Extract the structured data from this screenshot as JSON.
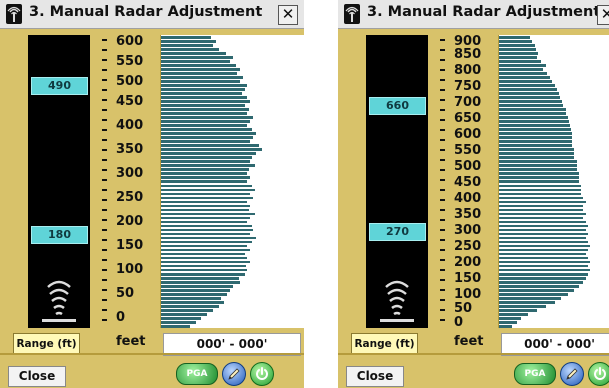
{
  "windows": [
    {
      "title": "3. Manual Radar Adjustment",
      "close_glyph": "✕",
      "ruler_markers": [
        "490",
        "180"
      ],
      "range_button": "Range (ft)",
      "axis_ticks": [
        "600",
        "550",
        "500",
        "450",
        "400",
        "350",
        "300",
        "250",
        "200",
        "150",
        "100",
        "50",
        "0"
      ],
      "axis_unit": "feet",
      "range_readout": "000' -  000'",
      "close_button": "Close",
      "pga_button": "PGA",
      "icons": [
        "radar-antenna-icon",
        "radar-waves-icon",
        "pencil-icon",
        "power-icon"
      ],
      "bar_levels": [
        0.35,
        0.38,
        0.36,
        0.4,
        0.45,
        0.5,
        0.48,
        0.52,
        0.55,
        0.53,
        0.57,
        0.55,
        0.6,
        0.58,
        0.56,
        0.6,
        0.62,
        0.58,
        0.61,
        0.6,
        0.64,
        0.62,
        0.6,
        0.63,
        0.66,
        0.64,
        0.62,
        0.68,
        0.7,
        0.66,
        0.63,
        0.62,
        0.65,
        0.61,
        0.6,
        0.62,
        0.6,
        0.63,
        0.65,
        0.62,
        0.64,
        0.6,
        0.62,
        0.61,
        0.65,
        0.62,
        0.6,
        0.63,
        0.64,
        0.62,
        0.66,
        0.63,
        0.6,
        0.62,
        0.58,
        0.6,
        0.62,
        0.59,
        0.6,
        0.58,
        0.54,
        0.55,
        0.5,
        0.48,
        0.46,
        0.42,
        0.44,
        0.4,
        0.36,
        0.32,
        0.28,
        0.24,
        0.2
      ]
    },
    {
      "title": "3. Manual Radar Adjustment",
      "close_glyph": "✕",
      "ruler_markers": [
        "660",
        "270"
      ],
      "range_button": "Range (ft)",
      "axis_ticks": [
        "900",
        "850",
        "800",
        "750",
        "700",
        "650",
        "600",
        "550",
        "500",
        "450",
        "400",
        "350",
        "300",
        "250",
        "200",
        "150",
        "100",
        "50",
        "0"
      ],
      "axis_unit": "feet",
      "range_readout": "000' -  000'",
      "close_button": "Close",
      "pga_button": "PGA",
      "icons": [
        "radar-antenna-icon",
        "radar-waves-icon",
        "pencil-icon",
        "power-icon"
      ],
      "bar_levels": [
        0.28,
        0.3,
        0.32,
        0.33,
        0.35,
        0.34,
        0.38,
        0.42,
        0.4,
        0.43,
        0.46,
        0.48,
        0.5,
        0.52,
        0.54,
        0.55,
        0.57,
        0.58,
        0.6,
        0.6,
        0.62,
        0.63,
        0.64,
        0.65,
        0.66,
        0.66,
        0.66,
        0.66,
        0.68,
        0.68,
        0.68,
        0.7,
        0.7,
        0.7,
        0.72,
        0.72,
        0.72,
        0.74,
        0.74,
        0.74,
        0.76,
        0.78,
        0.76,
        0.76,
        0.78,
        0.76,
        0.78,
        0.8,
        0.78,
        0.8,
        0.78,
        0.8,
        0.82,
        0.8,
        0.78,
        0.8,
        0.82,
        0.8,
        0.82,
        0.8,
        0.78,
        0.76,
        0.72,
        0.68,
        0.62,
        0.56,
        0.5,
        0.42,
        0.34,
        0.26,
        0.2,
        0.16,
        0.12
      ]
    }
  ]
}
